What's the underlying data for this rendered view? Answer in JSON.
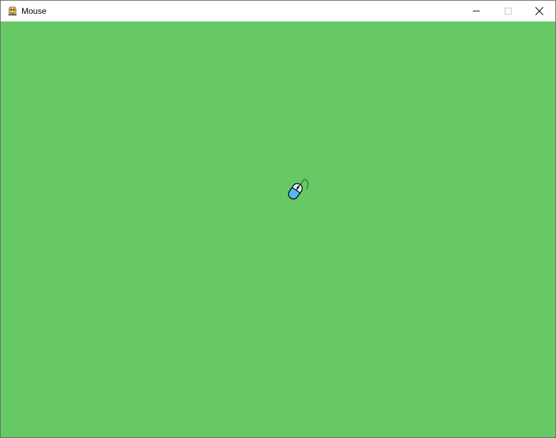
{
  "window": {
    "title": "Mouse",
    "app_icon": "pygame-snake-icon",
    "controls": {
      "minimize_icon": "minimize-icon",
      "maximize_icon": "maximize-icon",
      "close_icon": "close-icon"
    }
  },
  "canvas": {
    "background_color": "#66c966",
    "sprite": {
      "icon": "computer-mouse-icon",
      "body_color": "#4fb8f4",
      "button_color": "#dff2fb",
      "cord_color": "#1e7a2a"
    }
  },
  "colors": {
    "titlebar_bg": "#ffffff",
    "title_text": "#000000",
    "window_border": "#6b6b6b"
  }
}
